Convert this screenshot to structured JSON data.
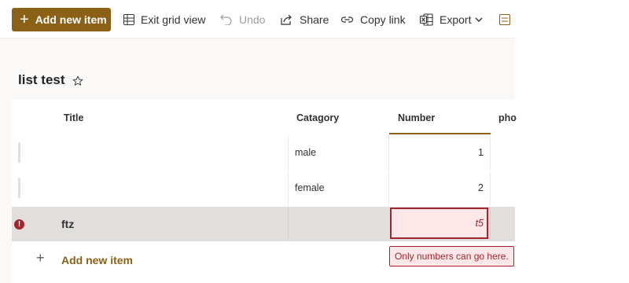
{
  "toolbar": {
    "add_new_item": "Add new item",
    "exit_grid_view": "Exit grid view",
    "undo": "Undo",
    "share": "Share",
    "copy_link": "Copy link",
    "export": "Export",
    "icons": [
      "plus-icon",
      "grid-icon",
      "undo-icon",
      "share-icon",
      "link-icon",
      "excel-icon",
      "chevron-down-icon",
      "form-icon"
    ]
  },
  "list": {
    "title": "list test",
    "favorite_icon": "star-icon"
  },
  "grid": {
    "columns": [
      "Title",
      "Catagory",
      "Number",
      "pho"
    ],
    "sorted_column": "Number",
    "rows": [
      {
        "title": "",
        "category": "male",
        "number": "1"
      },
      {
        "title": "",
        "category": "female",
        "number": "2"
      },
      {
        "title": "ftz",
        "category": "",
        "number": "t5",
        "error": true
      }
    ],
    "add_new_item": "Add new item"
  },
  "validation": {
    "message": "Only numbers can go here.",
    "icon": "error-icon"
  },
  "colors": {
    "accent": "#8a6116",
    "error": "#a4262c",
    "error_bg": "#fde7e9"
  }
}
